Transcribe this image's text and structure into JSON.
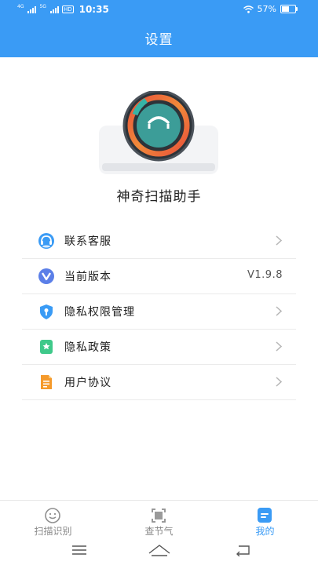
{
  "status": {
    "net1": "4G",
    "net2": "5G",
    "hd": "HD",
    "time": "10:35",
    "battery": "57%",
    "battery_fraction": 0.57
  },
  "header": {
    "title": "设置"
  },
  "app": {
    "name": "神奇扫描助手"
  },
  "menu": {
    "items": [
      {
        "label": "联系客服",
        "icon": "customer-service-icon"
      },
      {
        "label": "当前版本",
        "icon": "version-icon",
        "value": "V1.9.8"
      },
      {
        "label": "隐私权限管理",
        "icon": "privacy-shield-icon"
      },
      {
        "label": "隐私政策",
        "icon": "policy-bookmark-icon"
      },
      {
        "label": "用户协议",
        "icon": "document-icon"
      }
    ]
  },
  "tabs": [
    {
      "label": "扫描识别",
      "icon": "scan-icon",
      "active": false
    },
    {
      "label": "查节气",
      "icon": "frame-icon",
      "active": false
    },
    {
      "label": "我的",
      "icon": "profile-icon",
      "active": true
    }
  ],
  "colors": {
    "accent": "#3a9bf5",
    "inactive": "#888888"
  }
}
